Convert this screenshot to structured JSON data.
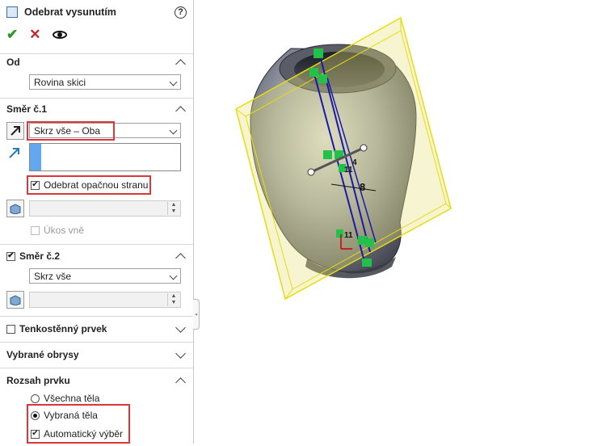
{
  "panel": {
    "title": "Odebrat vysunutím",
    "help_icon": "?",
    "actions": {
      "ok": "✔",
      "cancel": "✕"
    }
  },
  "od": {
    "header": "Od",
    "select_value": "Rovina skici"
  },
  "smer1": {
    "header": "Směr č.1",
    "end_condition": "Skrz vše – Oba",
    "flip_side_label": "Odebrat opačnou stranu",
    "flip_side_checked": true,
    "draft_outward_label": "Úkos vně"
  },
  "smer2": {
    "header": "Směr č.2",
    "checked": true,
    "end_condition": "Skrz vše"
  },
  "thin_feature": {
    "header": "Tenkostěnný prvek",
    "checked": false
  },
  "selected_contours": {
    "header": "Vybrané obrysy"
  },
  "feature_scope": {
    "header": "Rozsah prvku",
    "all_bodies_label": "Všechna těla",
    "selected_bodies_label": "Vybraná těla",
    "selected_bodies_checked": true,
    "auto_select_label": "Automatický výběr",
    "auto_select_checked": true
  },
  "viewport": {
    "dimension_label": "8",
    "relation_labels": [
      "11",
      "4",
      "11"
    ],
    "colors": {
      "plane_fill": "#e8e27a",
      "plane_edge": "#e6dc10",
      "sketch_line": "#1a1aa8",
      "handle": "#22c24a"
    }
  },
  "colors": {
    "highlight": "#d9383a",
    "accent_blue": "#62a8f0"
  }
}
